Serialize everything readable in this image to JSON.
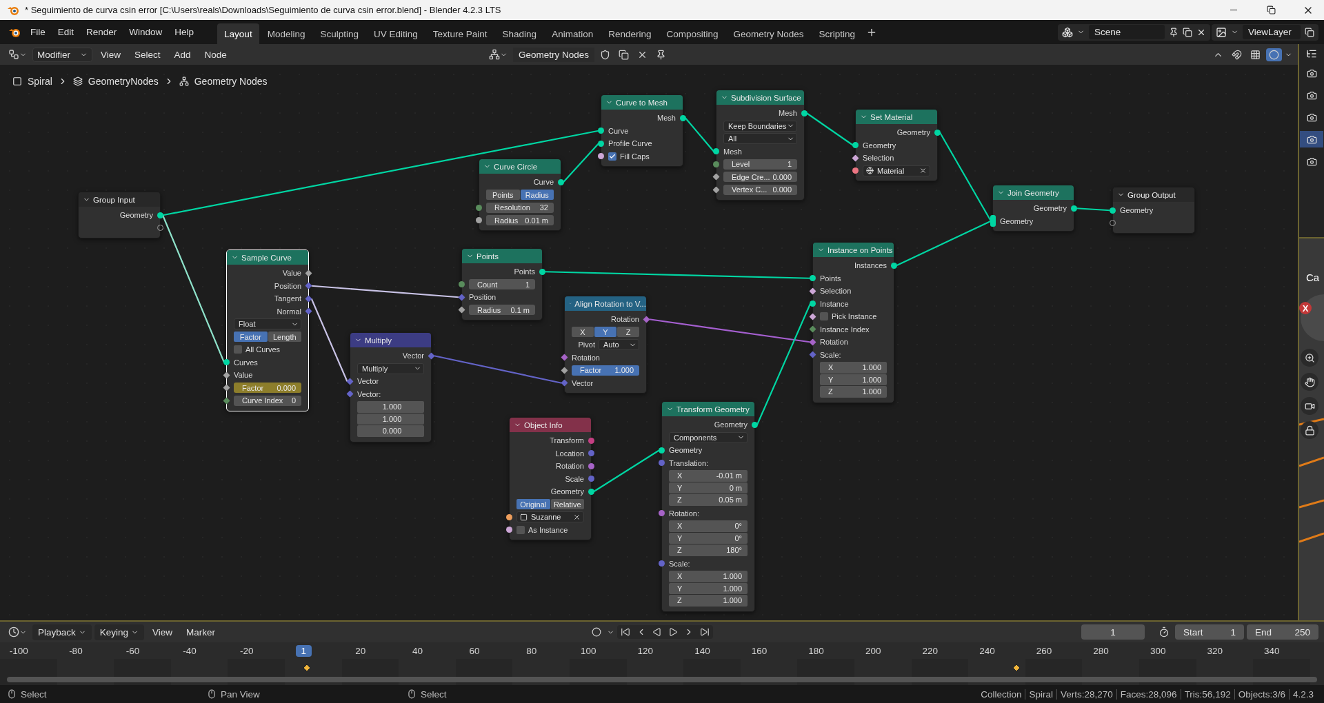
{
  "title_bar": {
    "title": "* Seguimiento de curva csin error [C:\\Users\\reals\\Downloads\\Seguimiento de curva csin error.blend] - Blender 4.2.3 LTS"
  },
  "menu": [
    "File",
    "Edit",
    "Render",
    "Window",
    "Help"
  ],
  "workspaces": [
    {
      "label": "Layout",
      "selected": true
    },
    {
      "label": "Modeling",
      "selected": false
    },
    {
      "label": "Sculpting",
      "selected": false
    },
    {
      "label": "UV Editing",
      "selected": false
    },
    {
      "label": "Texture Paint",
      "selected": false
    },
    {
      "label": "Shading",
      "selected": false
    },
    {
      "label": "Animation",
      "selected": false
    },
    {
      "label": "Rendering",
      "selected": false
    },
    {
      "label": "Compositing",
      "selected": false
    },
    {
      "label": "Geometry Nodes",
      "selected": false
    },
    {
      "label": "Scripting",
      "selected": false
    }
  ],
  "scene": {
    "value": "Scene"
  },
  "view_layer": {
    "value": "ViewLayer"
  },
  "editor_header": {
    "mode": "Modifier",
    "menus": [
      "View",
      "Select",
      "Add",
      "Node"
    ],
    "tree_name": "Geometry Nodes"
  },
  "breadcrumb": [
    "Spiral",
    "GeometryNodes",
    "Geometry Nodes"
  ],
  "nodes": [
    {
      "title": "Group Input",
      "color": "#282828",
      "selected": false,
      "rows": [
        {
          "kind": "output",
          "label": "Geometry",
          "color": "#00d6a3",
          "field": false
        },
        {
          "kind": "virtual_output"
        }
      ]
    },
    {
      "title": "Sample Curve",
      "color": "#1d725e",
      "selected": true,
      "rows": [
        {
          "kind": "output",
          "label": "Value",
          "color": "#a1a1a1",
          "field": true
        },
        {
          "kind": "output",
          "label": "Position",
          "color": "#6363c7",
          "field": true
        },
        {
          "kind": "output",
          "label": "Tangent",
          "color": "#6363c7",
          "field": true
        },
        {
          "kind": "output",
          "label": "Normal",
          "color": "#6363c7",
          "field": true
        },
        {
          "kind": "dropdown",
          "value": "Float"
        },
        {
          "kind": "toggle",
          "options": [
            {
              "label": "Factor",
              "selected": true
            },
            {
              "label": "Length",
              "selected": false
            }
          ]
        },
        {
          "kind": "checkbox",
          "label": "All Curves",
          "checked": false
        },
        {
          "kind": "input",
          "label": "Curves",
          "color": "#00d6a3",
          "field": false
        },
        {
          "kind": "input",
          "label": "Value",
          "color": "#a1a1a1",
          "field": true
        },
        {
          "kind": "field",
          "label": "Factor",
          "value": "0.000",
          "color": "#a1a1a1",
          "field": true,
          "keyframed": true
        },
        {
          "kind": "field",
          "label": "Curve Index",
          "value": "0",
          "color": "#598c5c",
          "field": true
        }
      ]
    },
    {
      "title": "Multiply",
      "color": "#3c3c83",
      "selected": false,
      "rows": [
        {
          "kind": "output",
          "label": "Vector",
          "color": "#6363c7",
          "field": true
        },
        {
          "kind": "dropdown",
          "value": "Multiply"
        },
        {
          "kind": "input",
          "label": "Vector",
          "color": "#6363c7",
          "field": true
        },
        {
          "kind": "input",
          "label": "Vector:",
          "color": "#6363c7",
          "field": true
        },
        {
          "kind": "values",
          "values": [
            {
              "value": "1.000"
            },
            {
              "value": "1.000"
            },
            {
              "value": "0.000"
            }
          ]
        }
      ]
    },
    {
      "title": "Curve Circle",
      "color": "#1d725e",
      "selected": false,
      "rows": [
        {
          "kind": "output",
          "label": "Curve",
          "color": "#00d6a3",
          "field": false
        },
        {
          "kind": "toggle",
          "options": [
            {
              "label": "Points",
              "selected": false
            },
            {
              "label": "Radius",
              "selected": true
            }
          ]
        },
        {
          "kind": "field",
          "label": "Resolution",
          "value": "32",
          "color": "#598c5c",
          "field": false
        },
        {
          "kind": "field",
          "label": "Radius",
          "value": "0.01 m",
          "color": "#a1a1a1",
          "field": false
        }
      ]
    },
    {
      "title": "Points",
      "color": "#1d725e",
      "selected": false,
      "rows": [
        {
          "kind": "output",
          "label": "Points",
          "color": "#00d6a3",
          "field": false
        },
        {
          "kind": "field",
          "label": "Count",
          "value": "1",
          "color": "#598c5c",
          "field": false
        },
        {
          "kind": "input",
          "label": "Position",
          "color": "#6363c7",
          "field": true
        },
        {
          "kind": "field",
          "label": "Radius",
          "value": "0.1 m",
          "color": "#a1a1a1",
          "field": true
        }
      ]
    },
    {
      "title": "Curve to Mesh",
      "color": "#1d725e",
      "selected": false,
      "rows": [
        {
          "kind": "output",
          "label": "Mesh",
          "color": "#00d6a3",
          "field": false
        },
        {
          "kind": "input",
          "label": "Curve",
          "color": "#00d6a3",
          "field": false
        },
        {
          "kind": "input",
          "label": "Profile Curve",
          "color": "#00d6a3",
          "field": false
        },
        {
          "kind": "checkbox",
          "label": "Fill Caps",
          "checked": true,
          "color": "#cca6d6",
          "field": false
        }
      ]
    },
    {
      "title": "Subdivision Surface",
      "color": "#1d725e",
      "selected": false,
      "rows": [
        {
          "kind": "output",
          "label": "Mesh",
          "color": "#00d6a3",
          "field": false
        },
        {
          "kind": "dropdown",
          "value": "Keep Boundaries"
        },
        {
          "kind": "dropdown",
          "value": "All"
        },
        {
          "kind": "input",
          "label": "Mesh",
          "color": "#00d6a3",
          "field": false
        },
        {
          "kind": "field",
          "label": "Level",
          "value": "1",
          "color": "#598c5c",
          "field": false
        },
        {
          "kind": "field",
          "label": "Edge Cre...",
          "value": "0.000",
          "color": "#a1a1a1",
          "field": true
        },
        {
          "kind": "field",
          "label": "Vertex C...",
          "value": "0.000",
          "color": "#a1a1a1",
          "field": true
        }
      ]
    },
    {
      "title": "Align Rotation to V...",
      "color": "#246283",
      "selected": false,
      "rows": [
        {
          "kind": "output",
          "label": "Rotation",
          "color": "#a663c7",
          "field": true
        },
        {
          "kind": "toggle",
          "options": [
            {
              "label": "X",
              "selected": false
            },
            {
              "label": "Y",
              "selected": true
            },
            {
              "label": "Z",
              "selected": false
            }
          ]
        },
        {
          "kind": "dropdown",
          "label": "Pivot",
          "value": "Auto"
        },
        {
          "kind": "input",
          "label": "Rotation",
          "color": "#a663c7",
          "field": true
        },
        {
          "kind": "field",
          "label": "Factor",
          "value": "1.000",
          "color": "#a1a1a1",
          "field": true,
          "level": 1
        },
        {
          "kind": "input",
          "label": "Vector",
          "color": "#6363c7",
          "field": true
        }
      ]
    },
    {
      "title": "Set Material",
      "color": "#1d725e",
      "selected": false,
      "rows": [
        {
          "kind": "output",
          "label": "Geometry",
          "color": "#00d6a3",
          "field": false
        },
        {
          "kind": "input",
          "label": "Geometry",
          "color": "#00d6a3",
          "field": false
        },
        {
          "kind": "input",
          "label": "Selection",
          "color": "#cca6d6",
          "field": true
        },
        {
          "kind": "material_picker",
          "value": "Material",
          "color": "#eb7582",
          "field": false
        }
      ]
    },
    {
      "title": "Join Geometry",
      "color": "#1d725e",
      "selected": false,
      "rows": [
        {
          "kind": "output",
          "label": "Geometry",
          "color": "#00d6a3",
          "field": false
        },
        {
          "kind": "input",
          "label": "Geometry",
          "color": "#00d6a3",
          "field": false,
          "multi": true
        }
      ]
    },
    {
      "title": "Group Output",
      "color": "#282828",
      "selected": false,
      "rows": [
        {
          "kind": "input",
          "label": "Geometry",
          "color": "#00d6a3",
          "field": false
        },
        {
          "kind": "virtual_input"
        }
      ]
    },
    {
      "title": "Instance on Points",
      "color": "#1d725e",
      "selected": false,
      "rows": [
        {
          "kind": "output",
          "label": "Instances",
          "color": "#00d6a3",
          "field": false
        },
        {
          "kind": "input",
          "label": "Points",
          "color": "#00d6a3",
          "field": false
        },
        {
          "kind": "input",
          "label": "Selection",
          "color": "#cca6d6",
          "field": true
        },
        {
          "kind": "input",
          "label": "Instance",
          "color": "#00d6a3",
          "field": false
        },
        {
          "kind": "checkbox",
          "label": "Pick Instance",
          "checked": false,
          "color": "#cca6d6",
          "field": true
        },
        {
          "kind": "input",
          "label": "Instance Index",
          "color": "#598c5c",
          "field": true
        },
        {
          "kind": "input",
          "label": "Rotation",
          "color": "#a663c7",
          "field": true
        },
        {
          "kind": "input",
          "label": "Scale:",
          "color": "#6363c7",
          "field": true
        },
        {
          "kind": "values",
          "values": [
            {
              "axis": "X",
              "value": "1.000"
            },
            {
              "axis": "Y",
              "value": "1.000"
            },
            {
              "axis": "Z",
              "value": "1.000"
            }
          ]
        }
      ]
    },
    {
      "title": "Object Info",
      "color": "#83314a",
      "selected": false,
      "rows": [
        {
          "kind": "output",
          "label": "Transform",
          "color": "#c43f82",
          "field": false
        },
        {
          "kind": "output",
          "label": "Location",
          "color": "#6363c7",
          "field": false
        },
        {
          "kind": "output",
          "label": "Rotation",
          "color": "#a663c7",
          "field": false
        },
        {
          "kind": "output",
          "label": "Scale",
          "color": "#6363c7",
          "field": false
        },
        {
          "kind": "output",
          "label": "Geometry",
          "color": "#00d6a3",
          "field": false
        },
        {
          "kind": "toggle",
          "options": [
            {
              "label": "Original",
              "selected": true
            },
            {
              "label": "Relative",
              "selected": false
            }
          ]
        },
        {
          "kind": "object_picker",
          "value": "Suzanne",
          "color": "#ed9e5c",
          "field": false
        },
        {
          "kind": "checkbox",
          "label": "As Instance",
          "checked": false,
          "color": "#cca6d6",
          "field": false
        }
      ]
    },
    {
      "title": "Transform Geometry",
      "color": "#1d725e",
      "selected": false,
      "rows": [
        {
          "kind": "output",
          "label": "Geometry",
          "color": "#00d6a3",
          "field": false
        },
        {
          "kind": "dropdown",
          "value": "Components"
        },
        {
          "kind": "input",
          "label": "Geometry",
          "color": "#00d6a3",
          "field": false
        },
        {
          "kind": "input",
          "label": "Translation:",
          "color": "#6363c7",
          "field": false
        },
        {
          "kind": "values",
          "values": [
            {
              "axis": "X",
              "value": "-0.01 m"
            },
            {
              "axis": "Y",
              "value": "0 m"
            },
            {
              "axis": "Z",
              "value": "0.05 m"
            }
          ]
        },
        {
          "kind": "input",
          "label": "Rotation:",
          "color": "#a663c7",
          "field": false
        },
        {
          "kind": "values",
          "values": [
            {
              "axis": "X",
              "value": "0°"
            },
            {
              "axis": "Y",
              "value": "0°"
            },
            {
              "axis": "Z",
              "value": "180°"
            }
          ]
        },
        {
          "kind": "input",
          "label": "Scale:",
          "color": "#6363c7",
          "field": false
        },
        {
          "kind": "values",
          "values": [
            {
              "axis": "X",
              "value": "1.000"
            },
            {
              "axis": "Y",
              "value": "1.000"
            },
            {
              "axis": "Z",
              "value": "1.000"
            }
          ]
        }
      ]
    }
  ],
  "right_strip": {
    "tabs": [
      {
        "selected": false
      },
      {
        "selected": false
      },
      {
        "selected": false
      },
      {
        "selected": true
      },
      {
        "selected": false
      }
    ],
    "viewport": {
      "label": "Ca",
      "axis": "X"
    }
  },
  "timeline": {
    "menus": [
      {
        "label": "Playback",
        "dropdown": true
      },
      {
        "label": "Keying",
        "dropdown": true
      },
      {
        "label": "View",
        "dropdown": false
      },
      {
        "label": "Marker",
        "dropdown": false
      }
    ],
    "current_frame": "1",
    "start": {
      "label": "Start",
      "value": "1"
    },
    "end": {
      "label": "End",
      "value": "250"
    },
    "ruler": [
      "-100",
      "-80",
      "-60",
      "-40",
      "-20",
      "20",
      "40",
      "60",
      "80",
      "100",
      "120",
      "140",
      "160",
      "180",
      "200",
      "220",
      "240",
      "260",
      "280",
      "300",
      "320",
      "340"
    ],
    "ruler_current": "1"
  },
  "status_bar": {
    "hints": [
      "Select",
      "Pan View",
      "Select"
    ],
    "stats": [
      "Collection",
      "Spiral",
      "Verts:28,270",
      "Faces:28,096",
      "Tris:56,192",
      "Objects:3/6",
      "4.2.3"
    ]
  }
}
